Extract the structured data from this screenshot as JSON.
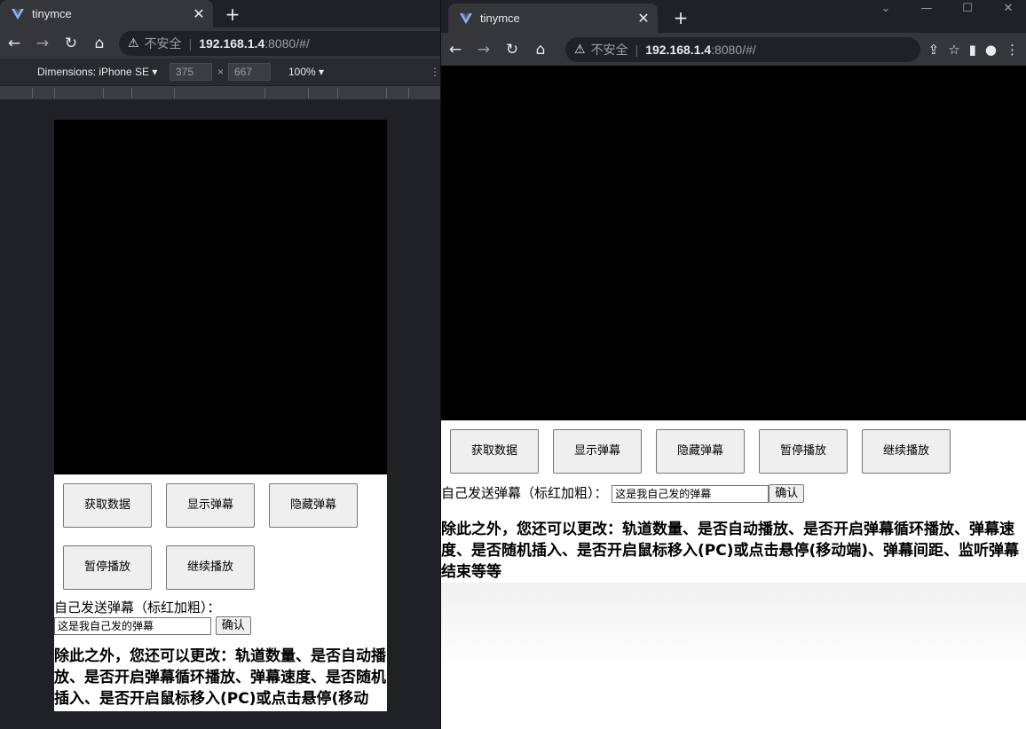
{
  "tab_title": "tinymce",
  "url": {
    "insecure_label": "不安全",
    "host": "192.168.1.4",
    "rest": ":8080/#/"
  },
  "devtools": {
    "device": "Dimensions: iPhone SE",
    "width": "375",
    "height": "667",
    "zoom": "100%",
    "times": "×"
  },
  "buttons": [
    "获取数据",
    "显示弹幕",
    "隐藏弹幕",
    "暂停播放",
    "继续播放"
  ],
  "send": {
    "label": "自己发送弹幕（标红加粗）：",
    "input_value": "这是我自己发的弹幕",
    "confirm": "确认"
  },
  "description": "除此之外，您还可以更改：轨道数量、是否自动播放、是否开启弹幕循环播放、弹幕速度、是否随机插入、是否开启鼠标移入(PC)或点击悬停(移动端)、弹幕间距、监听弹幕结束等等"
}
